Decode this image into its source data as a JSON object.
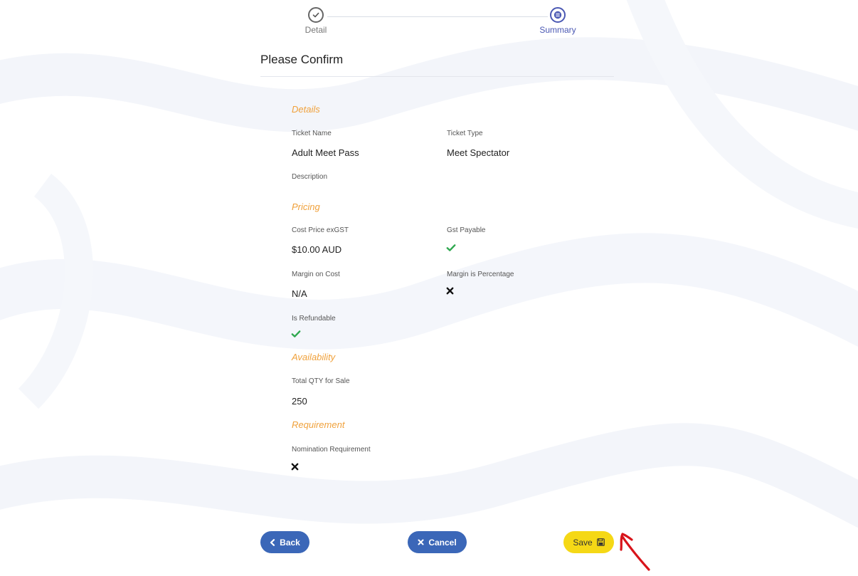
{
  "stepper": {
    "steps": [
      {
        "label": "Detail",
        "state": "completed"
      },
      {
        "label": "Summary",
        "state": "active"
      }
    ]
  },
  "page": {
    "title": "Please Confirm"
  },
  "details": {
    "heading": "Details",
    "ticket_name_label": "Ticket Name",
    "ticket_name_value": "Adult Meet Pass",
    "ticket_type_label": "Ticket Type",
    "ticket_type_value": "Meet Spectator",
    "description_label": "Description"
  },
  "pricing": {
    "heading": "Pricing",
    "cost_price_label": "Cost Price exGST",
    "cost_price_value": "$10.00 AUD",
    "gst_payable_label": "Gst Payable",
    "gst_payable_value": true,
    "margin_on_cost_label": "Margin on Cost",
    "margin_on_cost_value": "N/A",
    "margin_is_percentage_label": "Margin is Percentage",
    "margin_is_percentage_value": false,
    "is_refundable_label": "Is Refundable",
    "is_refundable_value": true
  },
  "availability": {
    "heading": "Availability",
    "total_qty_label": "Total QTY for Sale",
    "total_qty_value": "250"
  },
  "requirement": {
    "heading": "Requirement",
    "nomination_label": "Nomination Requirement",
    "nomination_value": false
  },
  "actions": {
    "back_label": "Back",
    "cancel_label": "Cancel",
    "save_label": "Save"
  },
  "colors": {
    "accent_blue": "#3b67b8",
    "stepper_active": "#4a58b3",
    "section_heading": "#f0a13b",
    "save_yellow": "#f5d816",
    "check_green": "#2fa84f",
    "annotation_red": "#d8141b"
  },
  "icons": {
    "detail_step": "check-circle-icon",
    "summary_step": "list-circle-icon",
    "true_value": "check-icon",
    "false_value": "x-icon",
    "back": "chevron-left-icon",
    "cancel": "x-icon",
    "save": "floppy-disk-icon"
  }
}
